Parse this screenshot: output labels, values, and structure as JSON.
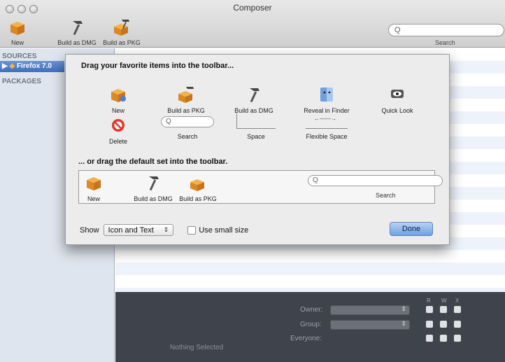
{
  "window": {
    "title": "Composer"
  },
  "toolbar": {
    "items": [
      {
        "label": "New",
        "icon": "new-package-icon"
      },
      {
        "label": "Build as DMG",
        "icon": "build-dmg-hammer-icon"
      },
      {
        "label": "Build as PKG",
        "icon": "build-pkg-icon"
      }
    ],
    "search_placeholder": "Q",
    "search_label": "Search"
  },
  "sidebar": {
    "sources_heading": "SOURCES",
    "selected_source": "Firefox 7.0",
    "packages_heading": "PACKAGES"
  },
  "customize_sheet": {
    "drag_heading": "Drag your favorite items into the toolbar...",
    "palette": {
      "new": "New",
      "build_pkg": "Build as PKG",
      "build_dmg": "Build as DMG",
      "reveal": "Reveal in Finder",
      "quick_look": "Quick Look",
      "delete": "Delete",
      "search": "Search",
      "space": "Space",
      "flexible_space": "Flexible Space"
    },
    "default_heading": "... or drag the default set into the toolbar.",
    "default_set": {
      "new": "New",
      "build_dmg": "Build as DMG",
      "build_pkg": "Build as PKG",
      "search_label": "Search"
    },
    "show_label": "Show",
    "show_value": "Icon and Text",
    "small_size_label": "Use small size",
    "done_label": "Done"
  },
  "permissions": {
    "owner_label": "Owner:",
    "group_label": "Group:",
    "everyone_label": "Everyone:",
    "r": "R",
    "w": "W",
    "x": "X",
    "empty_text": "Nothing Selected"
  },
  "colors": {
    "accent": "#3c6fbf",
    "done_button": "#6fa1e0"
  }
}
